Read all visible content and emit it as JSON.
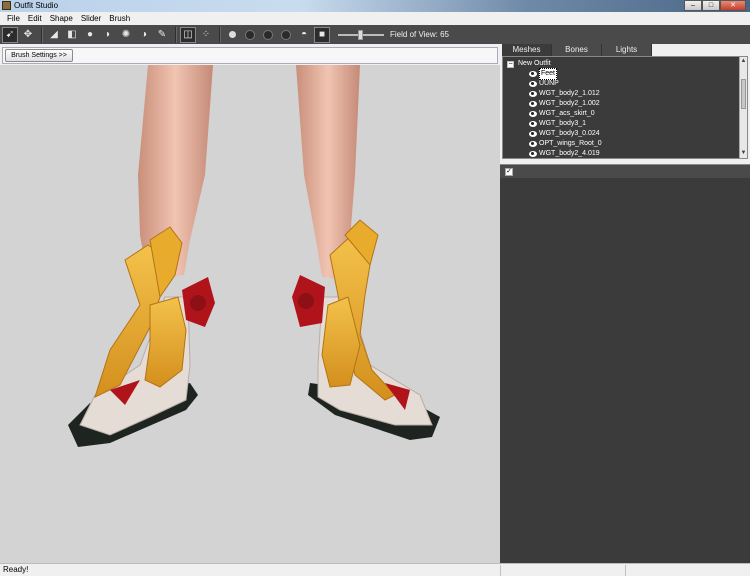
{
  "window": {
    "title": "Outfit Studio",
    "controls": [
      "–",
      "□",
      "✕"
    ]
  },
  "menu": [
    "File",
    "Edit",
    "Shape",
    "Slider",
    "Brush"
  ],
  "toolbar": {
    "field_of_view_label": "Field of View: 65",
    "field_of_view_value": 65,
    "icons": [
      "select-icon",
      "transform-icon",
      "inflate-brush-icon",
      "deflate-brush-icon",
      "move-brush-icon",
      "smooth-brush-icon",
      "mask-brush-icon",
      "unmask-brush-icon",
      "weight-brush-icon",
      "color-brush-icon",
      "mirror-icon",
      "connected-only-icon",
      "vertices-icon",
      "wireframe-icon",
      "lighting-icon",
      "texture-icon",
      "ortho-icon"
    ]
  },
  "brush_settings": {
    "label": "Brush Settings >>"
  },
  "tabs": [
    "Meshes",
    "Bones",
    "Lights"
  ],
  "mesh_tree": {
    "root": "New Outfit",
    "toggle": "−",
    "items": [
      "Feet",
      "UUNP",
      "WGT_body2_1.012",
      "WGT_body2_1.002",
      "WGT_acs_skirt_0",
      "WGT_body3_1",
      "WGT_body3_0.024",
      "OPT_wings_Root_0",
      "WGT_body2_4.019"
    ],
    "selected": "Feet"
  },
  "lower_panel": {
    "check": "✓"
  },
  "status": {
    "text": "Ready!"
  },
  "colors": {
    "viewport_bg": "#d3d3d3",
    "toolbar_bg": "#4a4a4a",
    "panel_bg": "#3b3b3b"
  }
}
